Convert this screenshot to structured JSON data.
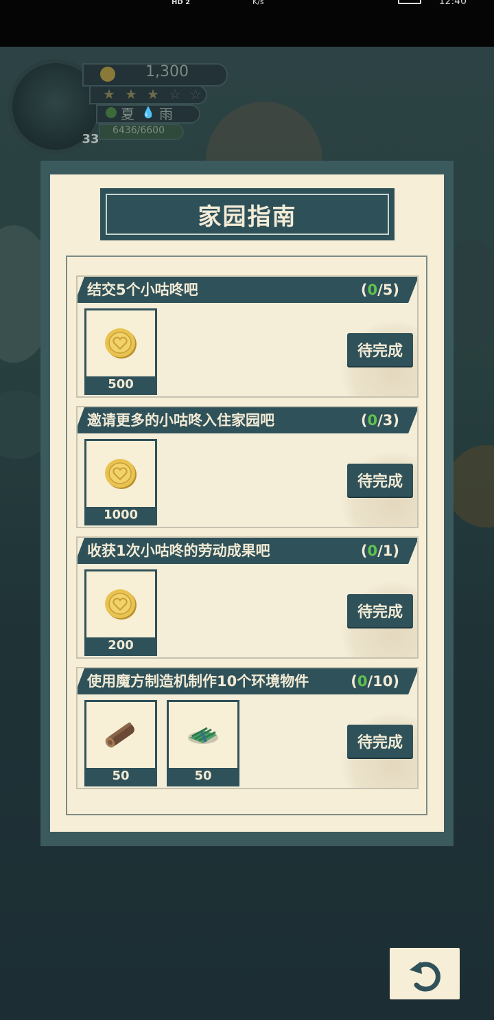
{
  "status_bar": {
    "hd": "HD 2",
    "net": "K/s",
    "time": "12:40"
  },
  "hud": {
    "coins": "1,300",
    "season": "夏",
    "weather": "雨",
    "exp": "6436/6600",
    "level": "33"
  },
  "dialog": {
    "title": "家园指南",
    "tasks": [
      {
        "title": "结交5个小咕咚吧",
        "current": "0",
        "total": "/5)",
        "open": "(",
        "rewards": [
          {
            "icon": "gold-coin-icon",
            "amount": "500"
          }
        ],
        "button": "待完成"
      },
      {
        "title": "邀请更多的小咕咚入住家园吧",
        "current": "0",
        "total": "/3)",
        "open": "(",
        "rewards": [
          {
            "icon": "gold-coin-icon",
            "amount": "1000"
          }
        ],
        "button": "待完成"
      },
      {
        "title": "收获1次小咕咚的劳动成果吧",
        "current": "0",
        "total": "/1)",
        "open": "(",
        "rewards": [
          {
            "icon": "gold-coin-icon",
            "amount": "200"
          }
        ],
        "button": "待完成"
      },
      {
        "title": "使用魔方制造机制作10个环境物件",
        "current": "0",
        "total": "/10)",
        "open": "(",
        "rewards": [
          {
            "icon": "wood-log-icon",
            "amount": "50"
          },
          {
            "icon": "grass-bundle-icon",
            "amount": "50"
          }
        ],
        "button": "待完成"
      }
    ]
  },
  "colors": {
    "plate": "#2f5159",
    "paper": "#f6eed6",
    "progress": "#5fc24f"
  }
}
